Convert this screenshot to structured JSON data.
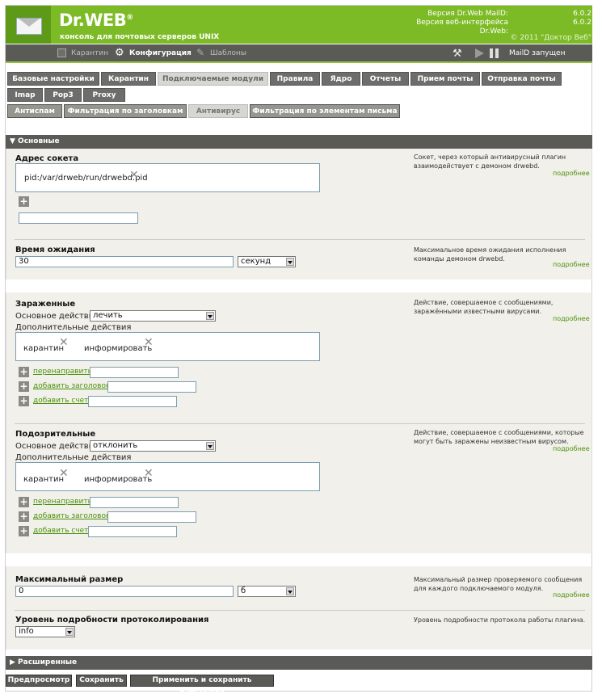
{
  "header": {
    "brand": "Dr.WEB",
    "tagline": "консоль для почтовых серверов UNIX",
    "ver_label1": "Версия Dr.Web MailD:",
    "ver_label2": "Версия веб-интерфейса Dr.Web:",
    "ver1": "6.0.2",
    "ver2": "6.0.2",
    "copyright": "© 2011 \"Доктор Веб\""
  },
  "menu": {
    "quarantine": "Карантин",
    "config": "Конфигурация",
    "templates": "Шаблоны",
    "status": "MailD запущен"
  },
  "tabs": {
    "base": "Базовые настройки",
    "quar": "Карантин",
    "modules": "Подключаемые модули",
    "rules": "Правила",
    "core": "Ядро",
    "reports": "Отчеты",
    "receive": "Прием почты",
    "send": "Отправка почты",
    "imap": "Imap",
    "pop3": "Pop3",
    "proxy": "Proxy"
  },
  "subtabs": {
    "antispam": "Антиспам",
    "headers": "Фильтрация по заголовкам",
    "antivirus": "Антивирус",
    "elements": "Фильтрация по элементам письма"
  },
  "section": {
    "main": "▼  Основные",
    "advanced": "▶  Расширенные"
  },
  "socket": {
    "label": "Адрес сокета",
    "value": "pid:/var/drweb/run/drwebd.pid",
    "desc": "Сокет, через который антивирусный плагин взаимодействует с демоном drwebd.",
    "more": "подробнее",
    "new_value": ""
  },
  "timeout": {
    "label": "Время ожидания",
    "value": "30",
    "unit": "секунд",
    "desc": "Максимальное время ожидания исполнения команды демоном drwebd.",
    "more": "подробнее"
  },
  "infected": {
    "label": "Зараженные",
    "main_label": "Основное действие",
    "main_value": "лечить",
    "extra_label": "Дополнительные действия",
    "tag1": "карантин",
    "tag2": "информировать",
    "redirect": "перенаправить",
    "add_header": "добавить заголовок",
    "add_score": "добавить счет",
    "desc": "Действие, совершаемое с сообщениями, заражёнными известными вирусами.",
    "more": "подробнее"
  },
  "suspicious": {
    "label": "Подозрительные",
    "main_label": "Основное действие",
    "main_value": "отклонить",
    "extra_label": "Дополнительные действия",
    "tag1": "карантин",
    "tag2": "информировать",
    "redirect": "перенаправить",
    "add_header": "добавить заголовок",
    "add_score": "добавить счет",
    "desc": "Действие, совершаемое с сообщениями, которые могут быть заражены неизвестным вирусом.",
    "more": "подробнее"
  },
  "maxsize": {
    "label": "Максимальный размер",
    "value": "0",
    "unit": "б",
    "desc": "Максимальный размер проверяемого сообщения для каждого подключаемого модуля.",
    "more": "подробнее"
  },
  "loglevel": {
    "label": "Уровень подробности протоколирования",
    "value": "info",
    "desc": "Уровень подробности протокола работы плагина."
  },
  "buttons": {
    "preview": "Предпросмотр",
    "save": "Сохранить",
    "apply": "Применить и сохранить изменения"
  }
}
